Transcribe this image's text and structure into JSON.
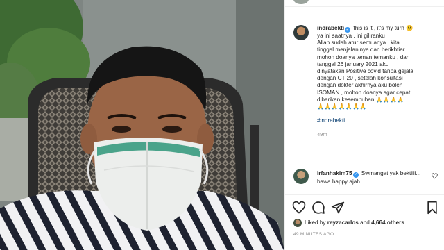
{
  "post": {
    "owner_username": "indrabekti",
    "caption_lines": [
      "this is it , it's my turn 🙂",
      "ya ini saatnya , ini giliranku",
      "Allah sudah atur semuanya , kita",
      "tinggal menjalaninya dan berikhtiar",
      "mohon doanya teman temanku , dari",
      "tanggal 26 january 2021 aku",
      "dinyatakan Positive covid tanpa gejala",
      "dengan CT 20 , setelah konsultasi",
      "dengan dokter akhirnya aku boleh",
      "ISOMAN , mohon doanya agar cepat",
      "diberikan kesembuhan 🙏🙏🙏🙏",
      "🙏🙏🙏🙏🙏🙏🙏"
    ],
    "hashtag": "#indrabekti",
    "caption_time": "49m"
  },
  "comment": {
    "username": "irfanhakim75",
    "text": "Swmangat yak bektiiii... bawa happy ajah"
  },
  "likes": {
    "prefix": "Liked by",
    "user": "reyzacarlos",
    "joiner": "and",
    "others": "4,664 others"
  },
  "posted_ago": "49 MINUTES AGO",
  "icons": {
    "like": "heart-icon",
    "comment": "comment-icon",
    "share": "share-icon",
    "save": "bookmark-icon",
    "verified": "verified-badge-icon"
  },
  "colors": {
    "verified": "#3897f0",
    "hashtag": "#00376b",
    "muted": "#8e8e8e",
    "text": "#262626"
  }
}
